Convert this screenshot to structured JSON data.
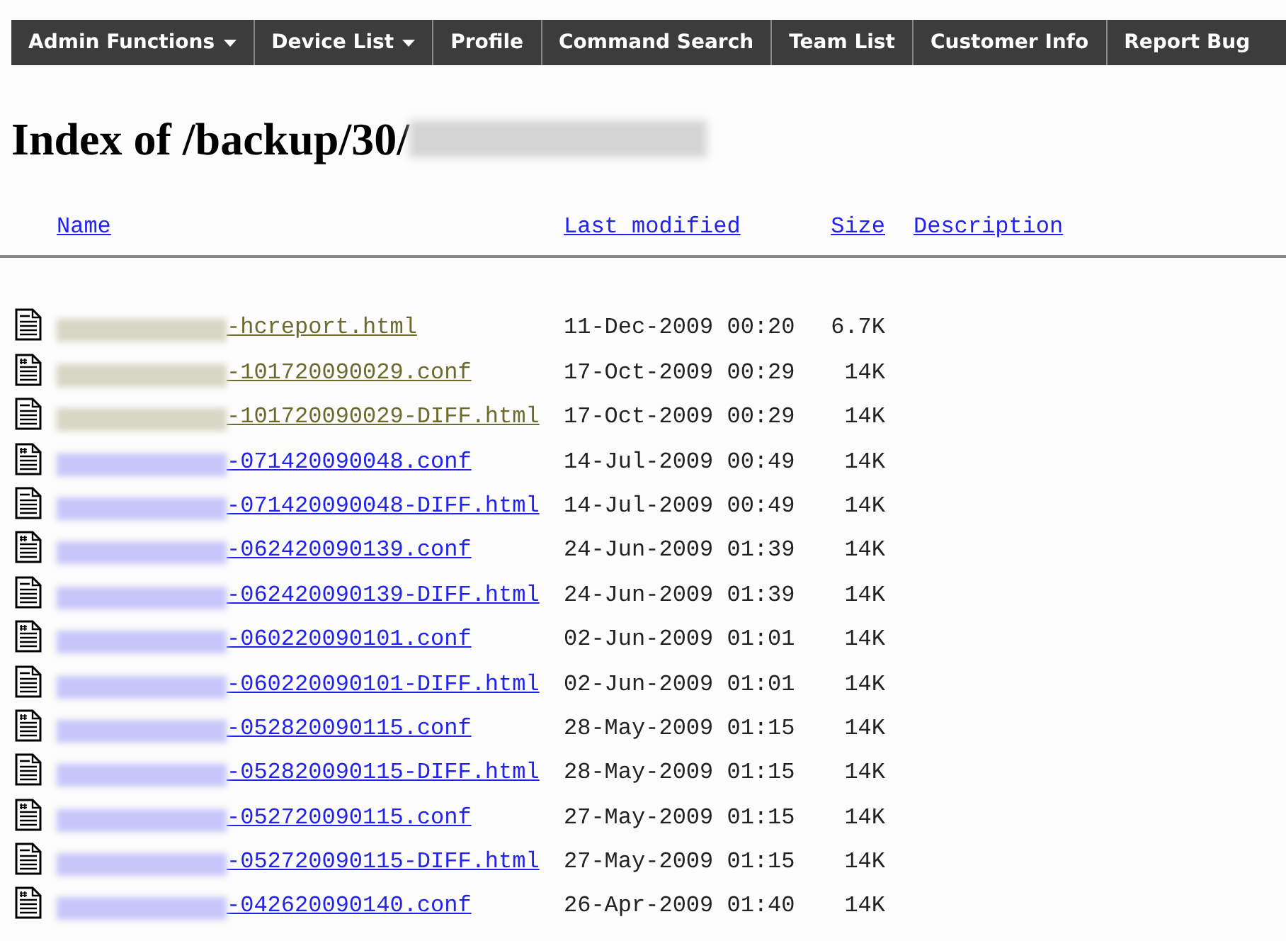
{
  "nav": [
    {
      "label": "Admin Functions",
      "dropdown": true
    },
    {
      "label": "Device List",
      "dropdown": true
    },
    {
      "label": "Profile",
      "dropdown": false
    },
    {
      "label": "Command Search",
      "dropdown": false
    },
    {
      "label": "Team List",
      "dropdown": false
    },
    {
      "label": "Customer Info",
      "dropdown": false
    },
    {
      "label": "Report Bug",
      "dropdown": false
    }
  ],
  "heading": "Index of /backup/30/",
  "columns": [
    "Name",
    "Last modified",
    "Size",
    "Description"
  ],
  "rows": [
    {
      "kind": "text",
      "name": "-hcreport.html",
      "visited": true,
      "modified": "11-Dec-2009 00:20",
      "size": "6.7K"
    },
    {
      "kind": "conf",
      "name": "-101720090029.conf",
      "visited": true,
      "modified": "17-Oct-2009 00:29",
      "size": "14K"
    },
    {
      "kind": "text",
      "name": "-101720090029-DIFF.html",
      "visited": true,
      "modified": "17-Oct-2009 00:29",
      "size": "14K"
    },
    {
      "kind": "conf",
      "name": "-071420090048.conf",
      "visited": false,
      "modified": "14-Jul-2009 00:49",
      "size": "14K"
    },
    {
      "kind": "text",
      "name": "-071420090048-DIFF.html",
      "visited": false,
      "modified": "14-Jul-2009 00:49",
      "size": "14K"
    },
    {
      "kind": "conf",
      "name": "-062420090139.conf",
      "visited": false,
      "modified": "24-Jun-2009 01:39",
      "size": "14K"
    },
    {
      "kind": "text",
      "name": "-062420090139-DIFF.html",
      "visited": false,
      "modified": "24-Jun-2009 01:39",
      "size": "14K"
    },
    {
      "kind": "conf",
      "name": "-060220090101.conf",
      "visited": false,
      "modified": "02-Jun-2009 01:01",
      "size": "14K"
    },
    {
      "kind": "text",
      "name": "-060220090101-DIFF.html",
      "visited": false,
      "modified": "02-Jun-2009 01:01",
      "size": "14K"
    },
    {
      "kind": "conf",
      "name": "-052820090115.conf",
      "visited": false,
      "modified": "28-May-2009 01:15",
      "size": "14K"
    },
    {
      "kind": "text",
      "name": "-052820090115-DIFF.html",
      "visited": false,
      "modified": "28-May-2009 01:15",
      "size": "14K"
    },
    {
      "kind": "conf",
      "name": "-052720090115.conf",
      "visited": false,
      "modified": "27-May-2009 01:15",
      "size": "14K"
    },
    {
      "kind": "text",
      "name": "-052720090115-DIFF.html",
      "visited": false,
      "modified": "27-May-2009 01:15",
      "size": "14K"
    },
    {
      "kind": "conf",
      "name": "-042620090140.conf",
      "visited": false,
      "modified": "26-Apr-2009 01:40",
      "size": "14K"
    }
  ]
}
